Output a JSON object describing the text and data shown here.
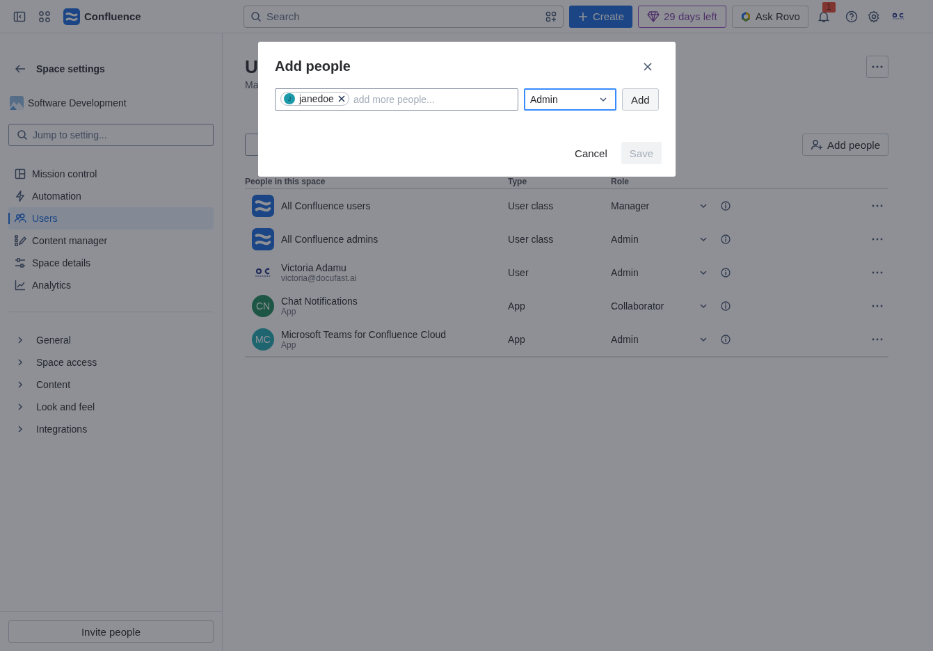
{
  "topbar": {
    "product": "Confluence",
    "search": {
      "placeholder": "Search"
    },
    "create": "Create",
    "trial": "29 days left",
    "ask": "Ask Rovo",
    "notifications": "1"
  },
  "sidebar": {
    "title": "Space settings",
    "space": "Software Development",
    "search": {
      "placeholder": "Jump to setting..."
    },
    "nav": [
      {
        "label": "Mission control",
        "selected": false
      },
      {
        "label": "Automation",
        "selected": false
      },
      {
        "label": "Users",
        "selected": true
      },
      {
        "label": "Content manager",
        "selected": false
      },
      {
        "label": "Space details",
        "selected": false
      },
      {
        "label": "Analytics",
        "selected": false
      }
    ],
    "sections": [
      {
        "label": "General",
        "expanded": false
      },
      {
        "label": "Space access",
        "expanded": false
      },
      {
        "label": "Content",
        "expanded": false
      },
      {
        "label": "Look and feel",
        "expanded": false
      },
      {
        "label": "Integrations",
        "expanded": false
      }
    ],
    "invite": "Invite people"
  },
  "page": {
    "title": "U",
    "description": "Ma",
    "add_button": "Add people",
    "table": {
      "columns": [
        "People in this space",
        "Type",
        "Role"
      ],
      "rows": [
        {
          "name": "All Confluence users",
          "avatar": {
            "kind": "logo"
          },
          "type": "User class",
          "role": "Manager"
        },
        {
          "name": "All Confluence admins",
          "avatar": {
            "kind": "logo"
          },
          "type": "User class",
          "role": "Admin"
        },
        {
          "name": "Victoria Adamu",
          "subtitle": "victoria@docufast.ai",
          "avatar": {
            "kind": "image"
          },
          "type": "User",
          "role": "Admin"
        },
        {
          "name": "Chat Notifications",
          "subtitle": "App",
          "avatar": {
            "kind": "initials",
            "initials": "CN",
            "color": "#1e5645"
          },
          "type": "App",
          "role": "Collaborator"
        },
        {
          "name": "Microsoft Teams for Confluence Cloud",
          "subtitle": "App",
          "avatar": {
            "kind": "initials",
            "initials": "MC",
            "color": "#1e6570"
          },
          "type": "App",
          "role": "Admin"
        }
      ]
    }
  },
  "dialog": {
    "title": "Add people",
    "people": [
      {
        "name": "janedoe",
        "initial": "J"
      }
    ],
    "placeholder": "add more people...",
    "role": "Admin",
    "add": "Add",
    "cancel": "Cancel",
    "save": "Save",
    "save_disabled": true
  }
}
